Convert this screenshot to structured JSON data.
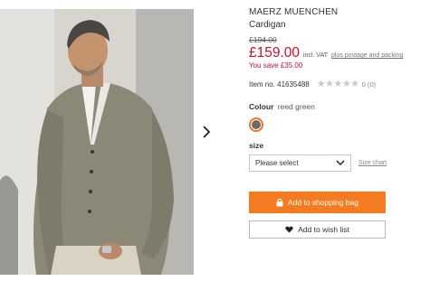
{
  "product": {
    "image": {
      "icon": "product-photo"
    },
    "next_image_icon": "chevron-right-icon",
    "brand": "MAERZ MUENCHEN",
    "name": "Cardigan",
    "old_price": "£194.00",
    "price": "£159.00",
    "vat_note": "incl. VAT",
    "postage_link": "plus postage and packing",
    "savings": "You save £35.00",
    "item_number": "Item no. 41635488",
    "rating": {
      "stars_max": 5,
      "stars_filled": 0,
      "count_label": "0 (0)"
    },
    "colour": {
      "label": "Colour",
      "value": "reed green",
      "swatch_color": "#6f6b63",
      "selected_ring_color": "#e8752a"
    },
    "size": {
      "label": "size",
      "select_value": "Please select",
      "chart_link": "Size chart"
    },
    "add_to_bag": {
      "label": "Add to shopping bag",
      "icon": "shopping-bag-icon",
      "color": "#f47b20"
    },
    "wishlist": {
      "label": "Add to wish list",
      "icon": "heart-icon"
    },
    "price_color": "#c8102e"
  }
}
